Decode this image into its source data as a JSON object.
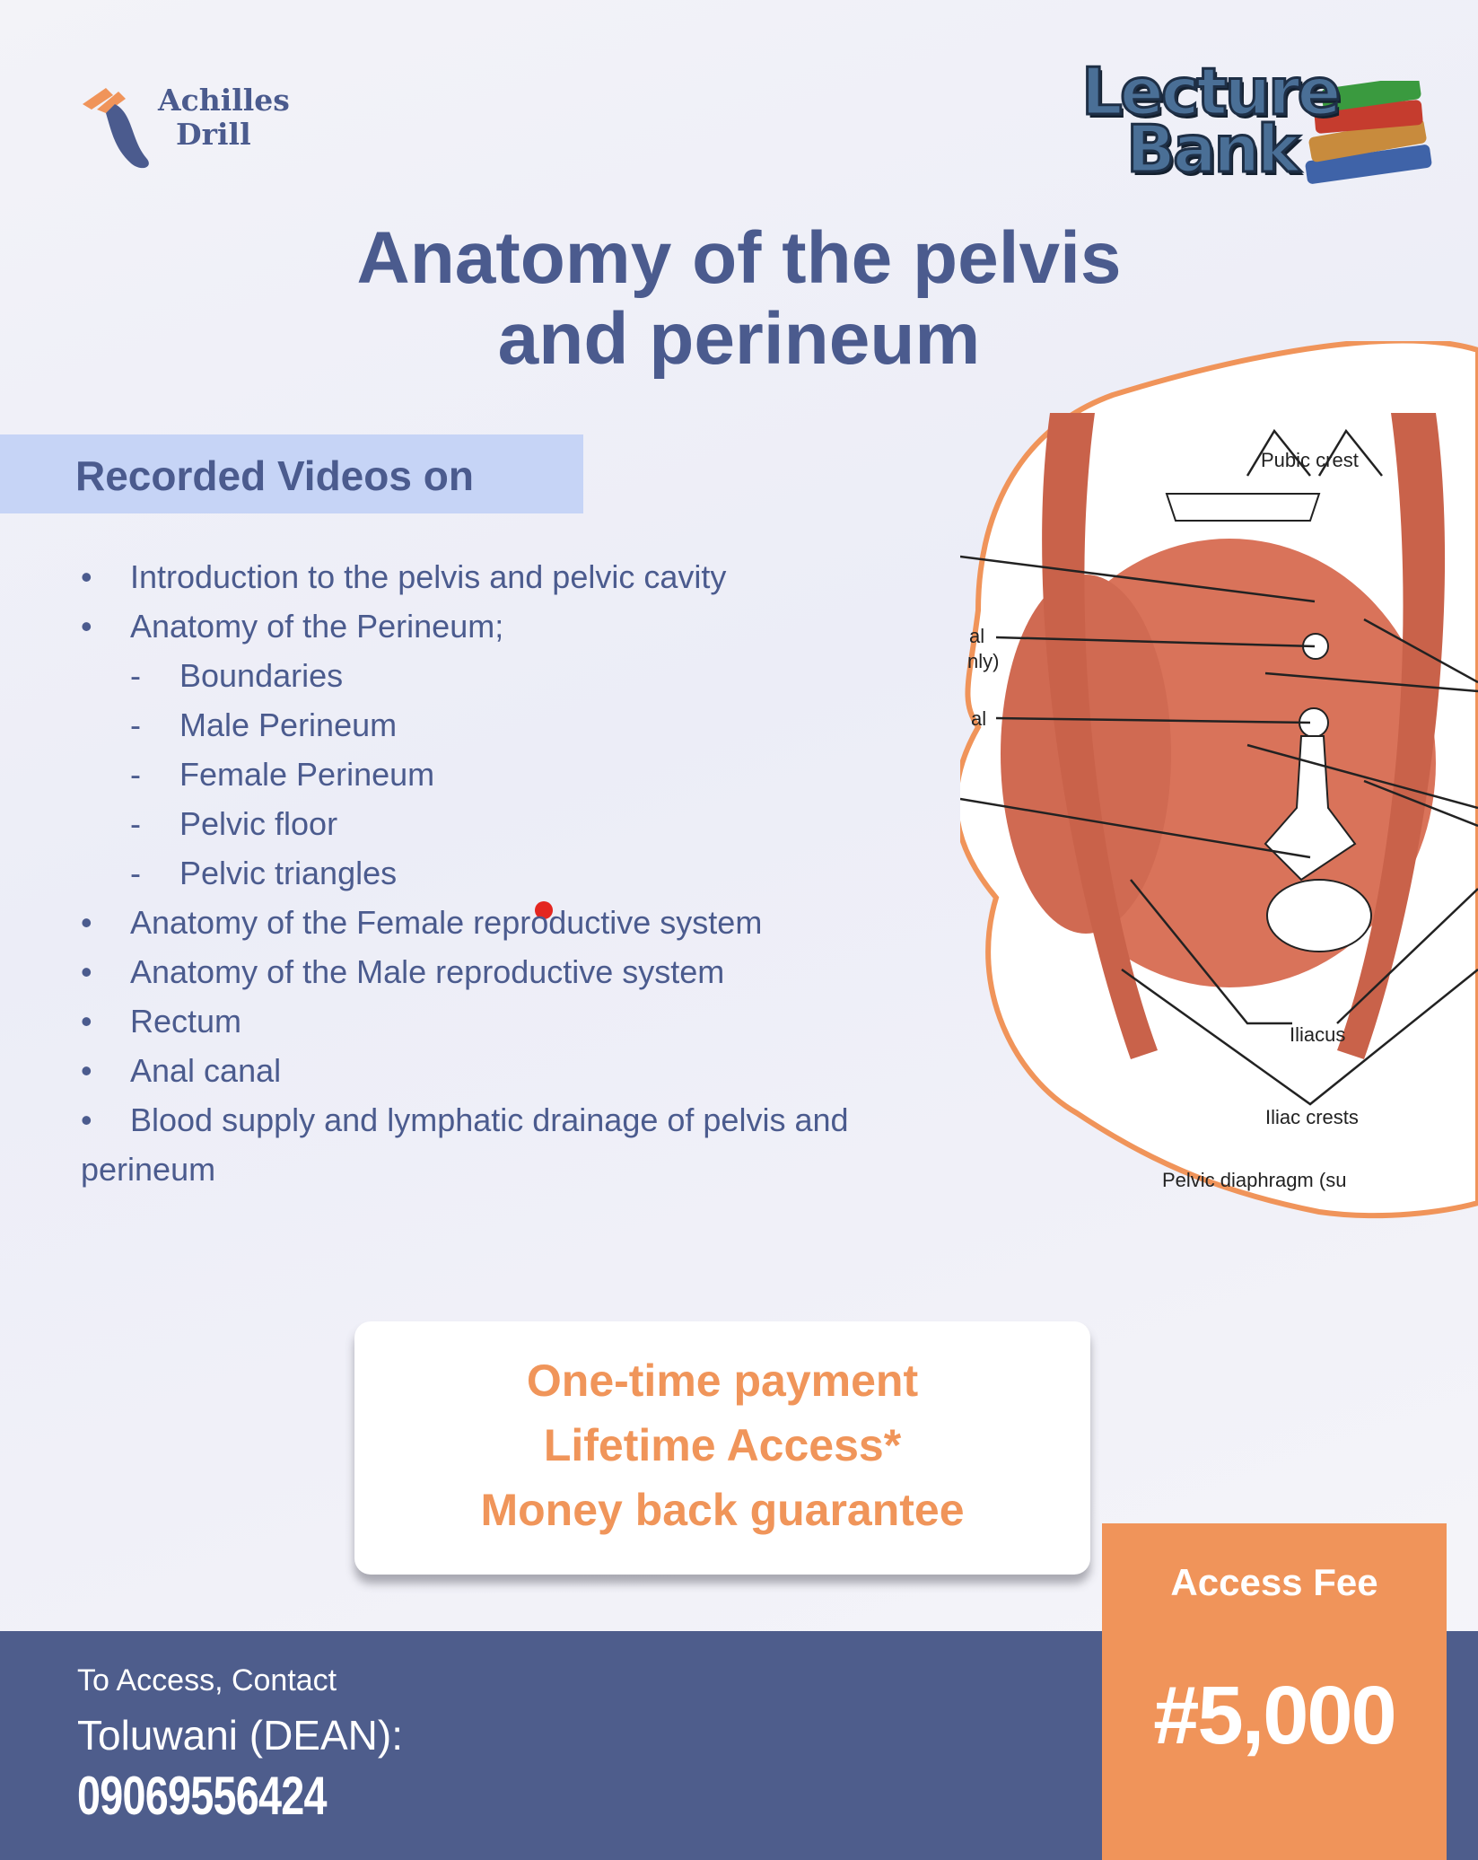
{
  "branding": {
    "left_logo": "Achilles Drill",
    "left_logo_lines": [
      "Achilles",
      "Drill"
    ],
    "right_logo_lines": [
      "Lecture",
      "Bank"
    ]
  },
  "title": {
    "line1": "Anatomy of the pelvis",
    "line2": "and perineum"
  },
  "banner": {
    "label": "Recorded Videos on",
    "dot_color": "#e42620"
  },
  "topics": [
    {
      "type": "bullet",
      "label": "Introduction to the pelvis and pelvic cavity"
    },
    {
      "type": "bullet",
      "label": "Anatomy of the Perineum;"
    },
    {
      "type": "sub",
      "label": "Boundaries"
    },
    {
      "type": "sub",
      "label": "Male Perineum"
    },
    {
      "type": "sub",
      "label": "Female Perineum"
    },
    {
      "type": "sub",
      "label": "Pelvic floor"
    },
    {
      "type": "sub",
      "label": "Pelvic triangles"
    },
    {
      "type": "bullet",
      "label": "Anatomy of the Female reproductive system"
    },
    {
      "type": "bullet",
      "label": "Anatomy of the Male reproductive system"
    },
    {
      "type": "bullet",
      "label": "Rectum"
    },
    {
      "type": "bullet",
      "label": "Anal canal"
    },
    {
      "type": "bullet",
      "label": "Blood supply and lymphatic drainage of pelvis and",
      "continuation": "perineum"
    }
  ],
  "bullet_glyph": "•",
  "sub_glyph": "-",
  "diagram": {
    "labels": {
      "pubic_crest": "Pubic crest",
      "iliacus": "Iliacus",
      "iliac_crests": "Iliac crests",
      "pelvic_diaphragm": "Pelvic diaphragm (su",
      "cut_1a": "al",
      "cut_1b": "nly)",
      "cut_2": "al"
    }
  },
  "payment": {
    "lines": [
      "One-time payment",
      "Lifetime Access*",
      "Money back guarantee"
    ]
  },
  "fee": {
    "label": "Access Fee",
    "value": "#5,000"
  },
  "contact": {
    "line1": "To Access, Contact",
    "line2": "Toluwani (DEAN):",
    "phone": "09069556424"
  },
  "colors": {
    "navy": "#4e5d8c",
    "orange": "#f0945a",
    "banner": "#c6d4f6",
    "text": "#4b5b8e",
    "muscle": "#d9735a"
  }
}
